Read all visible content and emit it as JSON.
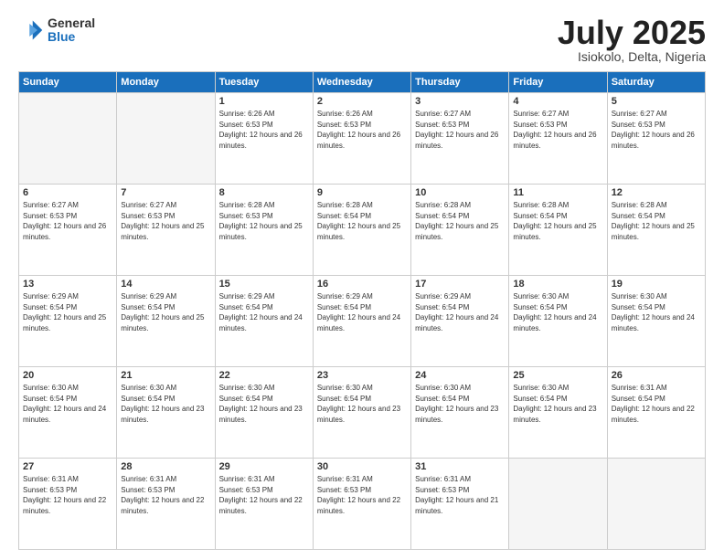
{
  "logo": {
    "general": "General",
    "blue": "Blue"
  },
  "header": {
    "month": "July 2025",
    "location": "Isiokolo, Delta, Nigeria"
  },
  "weekdays": [
    "Sunday",
    "Monday",
    "Tuesday",
    "Wednesday",
    "Thursday",
    "Friday",
    "Saturday"
  ],
  "weeks": [
    [
      {
        "day": null
      },
      {
        "day": null
      },
      {
        "day": "1",
        "sunrise": "6:26 AM",
        "sunset": "6:53 PM",
        "daylight": "12 hours and 26 minutes."
      },
      {
        "day": "2",
        "sunrise": "6:26 AM",
        "sunset": "6:53 PM",
        "daylight": "12 hours and 26 minutes."
      },
      {
        "day": "3",
        "sunrise": "6:27 AM",
        "sunset": "6:53 PM",
        "daylight": "12 hours and 26 minutes."
      },
      {
        "day": "4",
        "sunrise": "6:27 AM",
        "sunset": "6:53 PM",
        "daylight": "12 hours and 26 minutes."
      },
      {
        "day": "5",
        "sunrise": "6:27 AM",
        "sunset": "6:53 PM",
        "daylight": "12 hours and 26 minutes."
      }
    ],
    [
      {
        "day": "6",
        "sunrise": "6:27 AM",
        "sunset": "6:53 PM",
        "daylight": "12 hours and 26 minutes."
      },
      {
        "day": "7",
        "sunrise": "6:27 AM",
        "sunset": "6:53 PM",
        "daylight": "12 hours and 25 minutes."
      },
      {
        "day": "8",
        "sunrise": "6:28 AM",
        "sunset": "6:53 PM",
        "daylight": "12 hours and 25 minutes."
      },
      {
        "day": "9",
        "sunrise": "6:28 AM",
        "sunset": "6:54 PM",
        "daylight": "12 hours and 25 minutes."
      },
      {
        "day": "10",
        "sunrise": "6:28 AM",
        "sunset": "6:54 PM",
        "daylight": "12 hours and 25 minutes."
      },
      {
        "day": "11",
        "sunrise": "6:28 AM",
        "sunset": "6:54 PM",
        "daylight": "12 hours and 25 minutes."
      },
      {
        "day": "12",
        "sunrise": "6:28 AM",
        "sunset": "6:54 PM",
        "daylight": "12 hours and 25 minutes."
      }
    ],
    [
      {
        "day": "13",
        "sunrise": "6:29 AM",
        "sunset": "6:54 PM",
        "daylight": "12 hours and 25 minutes."
      },
      {
        "day": "14",
        "sunrise": "6:29 AM",
        "sunset": "6:54 PM",
        "daylight": "12 hours and 25 minutes."
      },
      {
        "day": "15",
        "sunrise": "6:29 AM",
        "sunset": "6:54 PM",
        "daylight": "12 hours and 24 minutes."
      },
      {
        "day": "16",
        "sunrise": "6:29 AM",
        "sunset": "6:54 PM",
        "daylight": "12 hours and 24 minutes."
      },
      {
        "day": "17",
        "sunrise": "6:29 AM",
        "sunset": "6:54 PM",
        "daylight": "12 hours and 24 minutes."
      },
      {
        "day": "18",
        "sunrise": "6:30 AM",
        "sunset": "6:54 PM",
        "daylight": "12 hours and 24 minutes."
      },
      {
        "day": "19",
        "sunrise": "6:30 AM",
        "sunset": "6:54 PM",
        "daylight": "12 hours and 24 minutes."
      }
    ],
    [
      {
        "day": "20",
        "sunrise": "6:30 AM",
        "sunset": "6:54 PM",
        "daylight": "12 hours and 24 minutes."
      },
      {
        "day": "21",
        "sunrise": "6:30 AM",
        "sunset": "6:54 PM",
        "daylight": "12 hours and 23 minutes."
      },
      {
        "day": "22",
        "sunrise": "6:30 AM",
        "sunset": "6:54 PM",
        "daylight": "12 hours and 23 minutes."
      },
      {
        "day": "23",
        "sunrise": "6:30 AM",
        "sunset": "6:54 PM",
        "daylight": "12 hours and 23 minutes."
      },
      {
        "day": "24",
        "sunrise": "6:30 AM",
        "sunset": "6:54 PM",
        "daylight": "12 hours and 23 minutes."
      },
      {
        "day": "25",
        "sunrise": "6:30 AM",
        "sunset": "6:54 PM",
        "daylight": "12 hours and 23 minutes."
      },
      {
        "day": "26",
        "sunrise": "6:31 AM",
        "sunset": "6:54 PM",
        "daylight": "12 hours and 22 minutes."
      }
    ],
    [
      {
        "day": "27",
        "sunrise": "6:31 AM",
        "sunset": "6:53 PM",
        "daylight": "12 hours and 22 minutes."
      },
      {
        "day": "28",
        "sunrise": "6:31 AM",
        "sunset": "6:53 PM",
        "daylight": "12 hours and 22 minutes."
      },
      {
        "day": "29",
        "sunrise": "6:31 AM",
        "sunset": "6:53 PM",
        "daylight": "12 hours and 22 minutes."
      },
      {
        "day": "30",
        "sunrise": "6:31 AM",
        "sunset": "6:53 PM",
        "daylight": "12 hours and 22 minutes."
      },
      {
        "day": "31",
        "sunrise": "6:31 AM",
        "sunset": "6:53 PM",
        "daylight": "12 hours and 21 minutes."
      },
      {
        "day": null
      },
      {
        "day": null
      }
    ]
  ]
}
